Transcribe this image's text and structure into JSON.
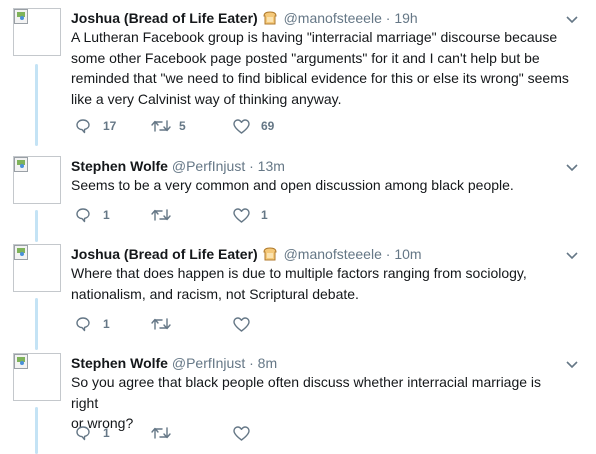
{
  "tweets": [
    {
      "name": "Joshua (Bread of Life Eater)",
      "emoji": "bread-icon",
      "handle": "@manofsteeele",
      "dot": "·",
      "time": "19h",
      "lines": [
        "A Lutheran Facebook group is having \"interracial marriage\" discourse because",
        "some other Facebook page posted \"arguments\" for it and I can't help but be",
        "reminded that \"we need to find biblical evidence for this or else its wrong\" seems",
        "like a very Calvinist way of thinking anyway."
      ],
      "replies": "17",
      "retweets": "5",
      "likes": "69"
    },
    {
      "name": "Stephen Wolfe",
      "handle": "@PerfInjust",
      "dot": "·",
      "time": "13m",
      "lines": [
        "Seems to be a very common and open discussion among black people."
      ],
      "replies": "1",
      "retweets": "",
      "likes": "1"
    },
    {
      "name": "Joshua (Bread of Life Eater)",
      "emoji": "bread-icon",
      "handle": "@manofsteeele",
      "dot": "·",
      "time": "10m",
      "lines": [
        "Where that does happen is due to multiple factors ranging from sociology,",
        "nationalism, and racism, not Scriptural debate."
      ],
      "replies": "1",
      "retweets": "",
      "likes": ""
    },
    {
      "name": "Stephen Wolfe",
      "handle": "@PerfInjust",
      "dot": "·",
      "time": "8m",
      "lines": [
        "So you agree that black people often discuss whether interracial marriage is right",
        "or wrong?"
      ],
      "replies": "1",
      "retweets": "",
      "likes": ""
    }
  ],
  "colors": {
    "text": "#14171a",
    "secondary": "#657786",
    "thread_line": "#c4e3f5"
  }
}
